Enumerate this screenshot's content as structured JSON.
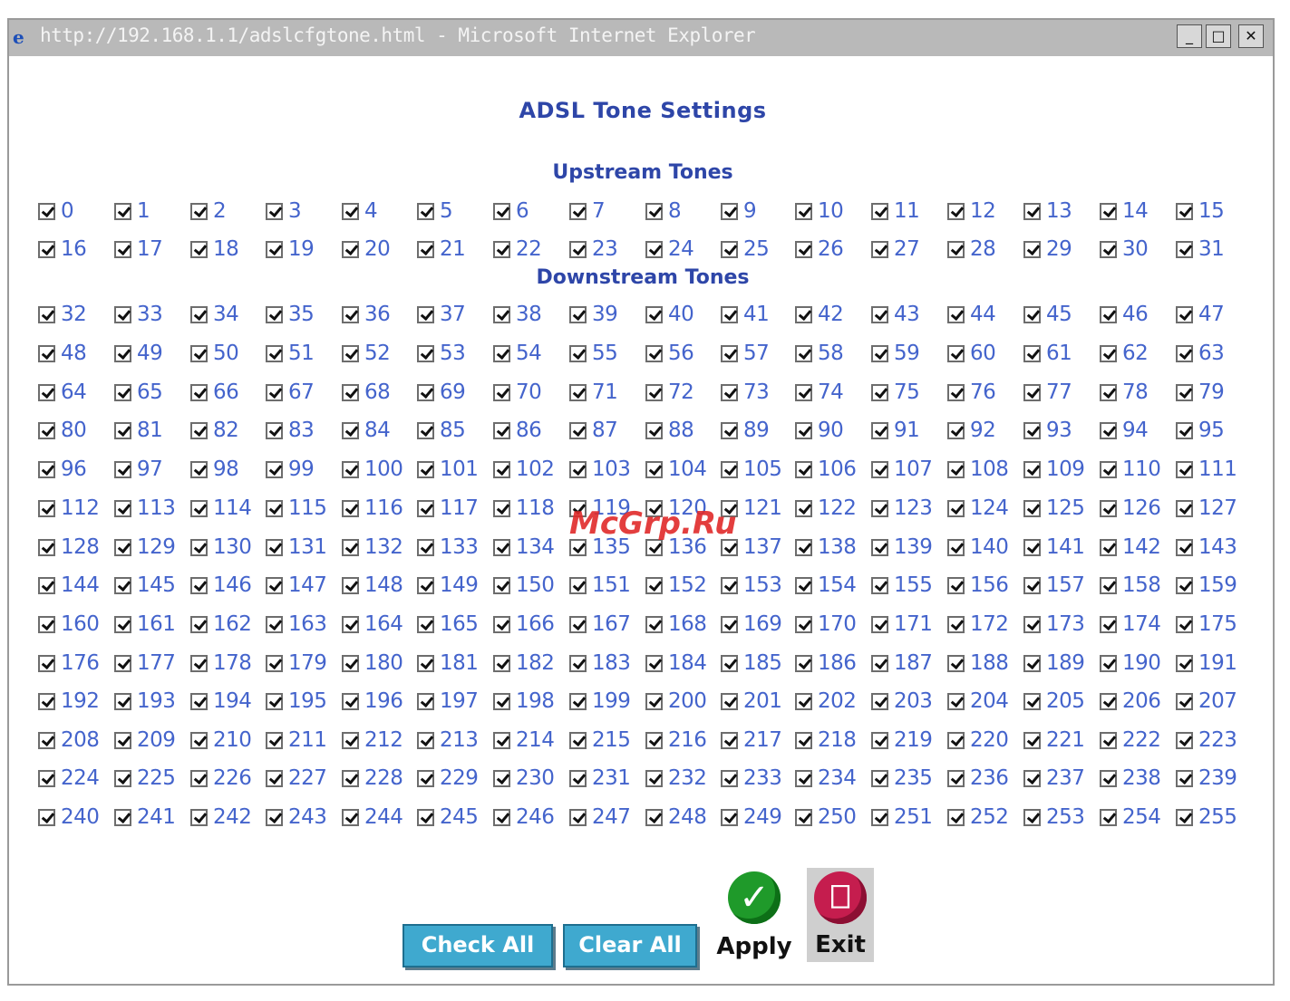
{
  "window": {
    "title": "http://192.168.1.1/adslcfgtone.html - Microsoft Internet Explorer",
    "minimize_glyph": "_",
    "maximize_glyph": "□",
    "close_glyph": "✕",
    "icon": "ie-page-icon"
  },
  "page": {
    "title": "ADSL Tone Settings",
    "upstream_label": "Upstream Tones",
    "downstream_label": "Downstream Tones"
  },
  "tones": {
    "upstream_range": [
      0,
      31
    ],
    "downstream_range": [
      32,
      255
    ],
    "all_checked": true,
    "columns": 16
  },
  "buttons": {
    "check_all": "Check All",
    "clear_all": "Clear All",
    "apply": "Apply",
    "apply_icon": "checkmark-icon",
    "exit": "Exit",
    "exit_icon": "door-exit-icon"
  },
  "watermark": "McGrp.Ru",
  "colors": {
    "label_blue": "#4464cc",
    "title_blue": "#2e46a8",
    "button_cyan": "#3fa9cf"
  }
}
